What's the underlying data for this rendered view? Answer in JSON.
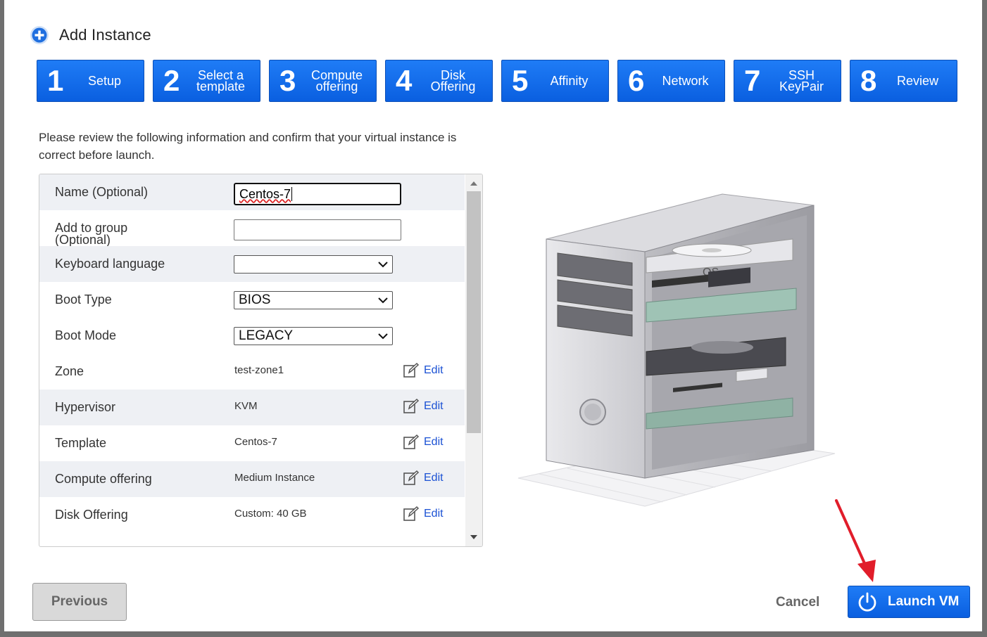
{
  "dialog": {
    "title": "Add Instance"
  },
  "steps": [
    {
      "number": "1",
      "label_line1": "Setup",
      "label_line2": ""
    },
    {
      "number": "2",
      "label_line1": "Select a",
      "label_line2": "template"
    },
    {
      "number": "3",
      "label_line1": "Compute",
      "label_line2": "offering"
    },
    {
      "number": "4",
      "label_line1": "Disk",
      "label_line2": "Offering"
    },
    {
      "number": "5",
      "label_line1": "Affinity",
      "label_line2": ""
    },
    {
      "number": "6",
      "label_line1": "Network",
      "label_line2": ""
    },
    {
      "number": "7",
      "label_line1": "SSH",
      "label_line2": "KeyPair"
    },
    {
      "number": "8",
      "label_line1": "Review",
      "label_line2": ""
    }
  ],
  "intro": "Please review the following information and confirm that your virtual instance is correct before launch.",
  "form": {
    "name_label": "Name (Optional)",
    "name_value": "Centos-7",
    "group_label_line1": "Add to group",
    "group_label_line2": "(Optional)",
    "group_value": "",
    "keyboard_label": "Keyboard language",
    "keyboard_value": "",
    "boot_type_label": "Boot Type",
    "boot_type_value": "BIOS",
    "boot_mode_label": "Boot Mode",
    "boot_mode_value": "LEGACY",
    "zone_label": "Zone",
    "zone_value": "test-zone1",
    "hypervisor_label": "Hypervisor",
    "hypervisor_value": "KVM",
    "template_label": "Template",
    "template_value": "Centos-7",
    "compute_label": "Compute offering",
    "compute_value": "Medium Instance",
    "disk_label": "Disk Offering",
    "disk_value": "Custom: 40 GB",
    "edit_label": "Edit"
  },
  "illustration": {
    "os_label": "OS"
  },
  "buttons": {
    "previous": "Previous",
    "cancel": "Cancel",
    "launch": "Launch VM"
  },
  "colors": {
    "accent": "#0a5fe0",
    "link": "#1c52d4",
    "annotation_arrow": "#e11d2a"
  }
}
